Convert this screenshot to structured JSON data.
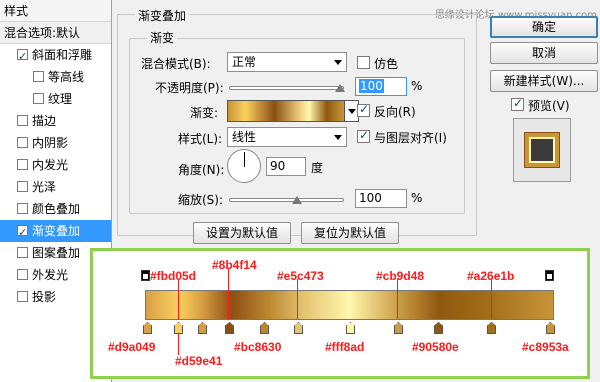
{
  "watermark": "思缘设计论坛 www.missyuan.com",
  "styles_panel": {
    "title": "样式",
    "blend_options": "混合选项:默认",
    "items": [
      {
        "label": "斜面和浮雕",
        "checked": true
      },
      {
        "label": "等高线",
        "checked": false
      },
      {
        "label": "纹理",
        "checked": false
      },
      {
        "label": "描边",
        "checked": false
      },
      {
        "label": "内阴影",
        "checked": false
      },
      {
        "label": "内发光",
        "checked": false
      },
      {
        "label": "光泽",
        "checked": false
      },
      {
        "label": "颜色叠加",
        "checked": false
      },
      {
        "label": "渐变叠加",
        "checked": true
      },
      {
        "label": "图案叠加",
        "checked": false
      },
      {
        "label": "外发光",
        "checked": false
      },
      {
        "label": "投影",
        "checked": false
      }
    ]
  },
  "gradient_overlay": {
    "group_title": "渐变叠加",
    "sub_title": "渐变",
    "blend_mode_label": "混合模式(B):",
    "blend_mode_value": "正常",
    "dither_label": "仿色",
    "opacity_label": "不透明度(P):",
    "opacity_value": "100",
    "opacity_unit": "%",
    "gradient_label": "渐变:",
    "reverse_label": "反向(R)",
    "style_label": "样式(L):",
    "style_value": "线性",
    "align_label": "与图层对齐(I)",
    "angle_label": "角度(N):",
    "angle_value": "90",
    "angle_unit": "度",
    "scale_label": "缩放(S):",
    "scale_value": "100",
    "scale_unit": "%",
    "make_default": "设置为默认值",
    "reset_default": "复位为默认值"
  },
  "buttons": {
    "ok": "确定",
    "cancel": "取消",
    "new_style": "新建样式(W)...",
    "preview_label": "预览(V)"
  },
  "gradient_stops": {
    "top_labels": [
      "#fbd05d",
      "#8b4f14",
      "#e5c473",
      "#cb9d48",
      "#a26e1b"
    ],
    "bottom_labels": [
      "#d9a049",
      "#d59e41",
      "#bc8630",
      "#fff8ad",
      "#90580e",
      "#c8953a"
    ],
    "colors": [
      "#d9a049",
      "#fbd05d",
      "#d59e41",
      "#8b4f14",
      "#bc8630",
      "#e5c473",
      "#fff8ad",
      "#cb9d48",
      "#90580e",
      "#a26e1b",
      "#c8953a"
    ]
  }
}
